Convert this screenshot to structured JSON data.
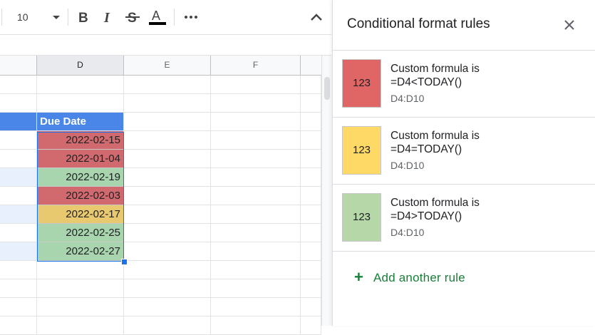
{
  "toolbar": {
    "font_size": "10",
    "icons": [
      "chevron-down-icon",
      "bold-icon",
      "italic-icon",
      "strikethrough-icon",
      "text-color-icon",
      "more-icon",
      "collapse-icon"
    ]
  },
  "grid": {
    "columns": [
      "D",
      "E",
      "F"
    ],
    "header_label": "Due Date",
    "dates": [
      "2022-02-15",
      "2022-01-04",
      "2022-02-19",
      "2022-02-03",
      "2022-02-17",
      "2022-02-25",
      "2022-02-27"
    ],
    "date_fills": [
      "#d06a6e",
      "#d06a6e",
      "#a8d5ae",
      "#d06a6e",
      "#e8c96f",
      "#a8d5ae",
      "#a8d5ae"
    ],
    "colors": {
      "header_fill": "#4a86e8",
      "selection": "#1a73e8",
      "row_band": "#e8f0fe"
    }
  },
  "panel": {
    "title": "Conditional format rules",
    "rules": [
      {
        "swatch_text": "123",
        "swatch_color": "#e06666",
        "line1": "Custom formula is",
        "line2": "=D4<TODAY()",
        "range": "D4:D10"
      },
      {
        "swatch_text": "123",
        "swatch_color": "#ffd966",
        "line1": "Custom formula is",
        "line2": "=D4=TODAY()",
        "range": "D4:D10"
      },
      {
        "swatch_text": "123",
        "swatch_color": "#b6d7a8",
        "line1": "Custom formula is",
        "line2": "=D4>TODAY()",
        "range": "D4:D10"
      }
    ],
    "add_rule_label": "Add another rule",
    "accent_color": "#188038"
  }
}
